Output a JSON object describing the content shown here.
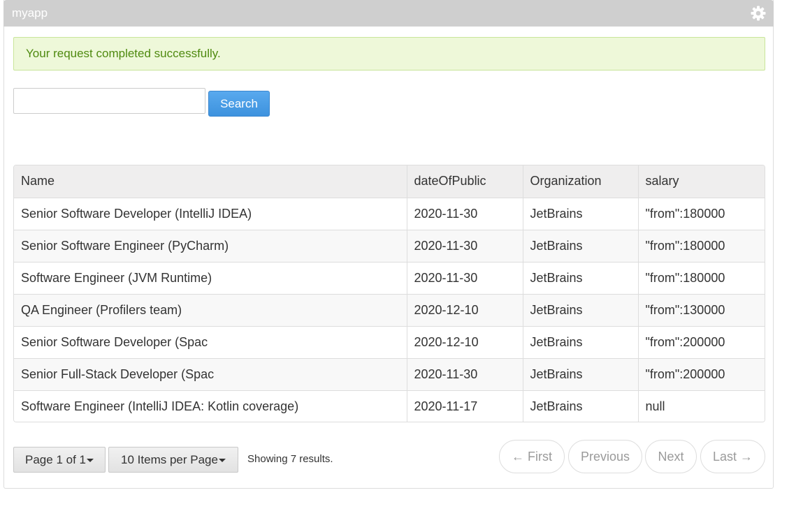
{
  "app": {
    "title": "myapp",
    "settings_icon": "gear-icon"
  },
  "alert": {
    "message": "Your request completed successfully."
  },
  "search": {
    "value": "",
    "button_label": "Search"
  },
  "table": {
    "columns": [
      "Name",
      "dateOfPublic",
      "Organization",
      "salary"
    ],
    "rows": [
      [
        "Senior Software Developer (IntelliJ IDEA)",
        "2020-11-30",
        "JetBrains",
        "\"from\":180000"
      ],
      [
        "Senior Software Engineer (PyCharm)",
        "2020-11-30",
        "JetBrains",
        "\"from\":180000"
      ],
      [
        "Software Engineer (JVM Runtime)",
        "2020-11-30",
        "JetBrains",
        "\"from\":180000"
      ],
      [
        "QA Engineer (Profilers team)",
        "2020-12-10",
        "JetBrains",
        "\"from\":130000"
      ],
      [
        "Senior Software Developer (Spac",
        "2020-12-10",
        "JetBrains",
        "\"from\":200000"
      ],
      [
        "Senior Full-Stack Developer (Spac",
        "2020-11-30",
        "JetBrains",
        "\"from\":200000"
      ],
      [
        "Software Engineer (IntelliJ IDEA: Kotlin coverage)",
        "2020-11-17",
        "JetBrains",
        "null"
      ]
    ]
  },
  "pagination": {
    "page_label": "Page 1 of 1",
    "items_per_page_label": "10 Items per Page",
    "showing_text": "Showing 7 results.",
    "first_label": "← First",
    "previous_label": "Previous",
    "next_label": "Next",
    "last_label": "Last →"
  },
  "colors": {
    "titlebar": "#cfcfcf",
    "alert_bg": "#eef8d9",
    "alert_text": "#4f8a10",
    "primary_button": "#4a9ee8"
  }
}
